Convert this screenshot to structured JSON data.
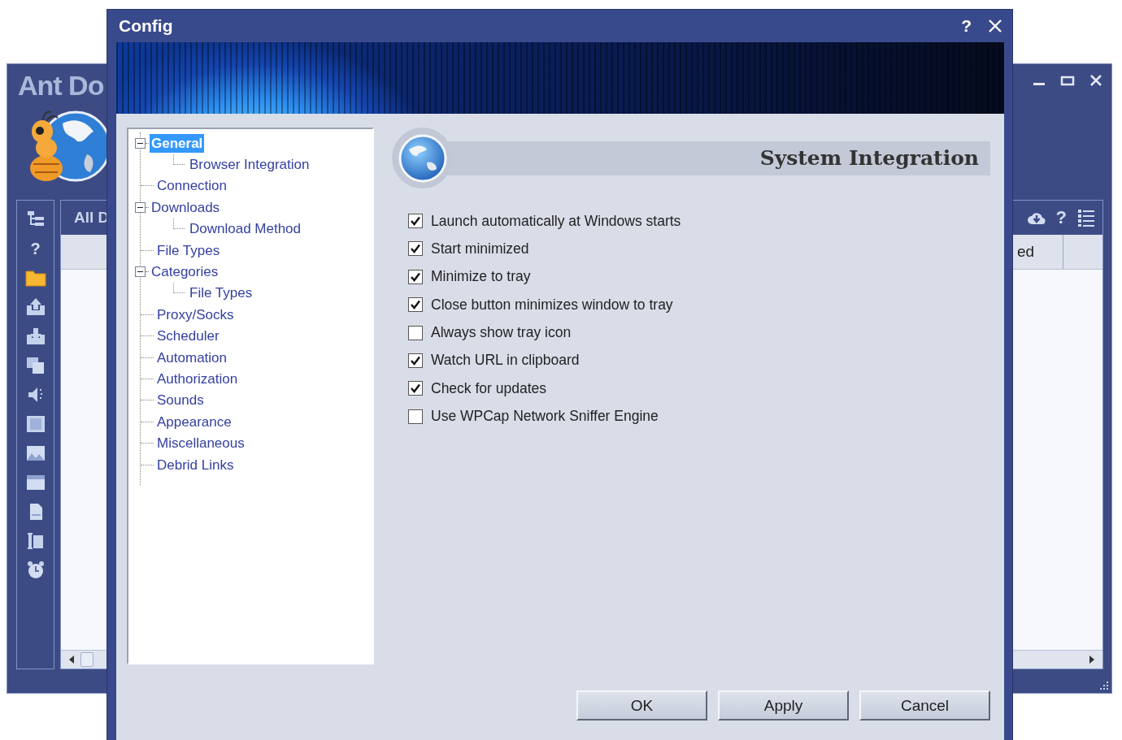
{
  "background_window": {
    "title": "Ant Do",
    "toolbar_help": "?",
    "tab": "All D",
    "column_header": "ed",
    "header_help": "?"
  },
  "dialog": {
    "title": "Config",
    "help": "?"
  },
  "tree": [
    {
      "label": "General",
      "selected": true,
      "expanded": true,
      "children": [
        {
          "label": "Browser Integration",
          "selected": false
        }
      ]
    },
    {
      "label": "Connection",
      "selected": false
    },
    {
      "label": "Downloads",
      "selected": false,
      "expanded": true,
      "children": [
        {
          "label": "Download Method",
          "selected": false
        }
      ]
    },
    {
      "label": "File Types",
      "selected": false
    },
    {
      "label": "Categories",
      "selected": false,
      "expanded": true,
      "children": [
        {
          "label": "File Types",
          "selected": false
        }
      ]
    },
    {
      "label": "Proxy/Socks",
      "selected": false
    },
    {
      "label": "Scheduler",
      "selected": false
    },
    {
      "label": "Automation",
      "selected": false
    },
    {
      "label": "Authorization",
      "selected": false
    },
    {
      "label": "Sounds",
      "selected": false
    },
    {
      "label": "Appearance",
      "selected": false
    },
    {
      "label": "Miscellaneous",
      "selected": false
    },
    {
      "label": "Debrid Links",
      "selected": false
    }
  ],
  "section_title": "System Integration",
  "options": [
    {
      "label": "Launch automatically at Windows starts",
      "checked": true
    },
    {
      "label": "Start minimized",
      "checked": true
    },
    {
      "label": "Minimize to tray",
      "checked": true
    },
    {
      "label": "Close button minimizes window to tray",
      "checked": true
    },
    {
      "label": "Always show tray icon",
      "checked": false
    },
    {
      "label": "Watch URL in clipboard",
      "checked": true
    },
    {
      "label": "Check for updates",
      "checked": true
    },
    {
      "label": "Use WPCap Network Sniffer Engine",
      "checked": false
    }
  ],
  "buttons": [
    "OK",
    "Apply",
    "Cancel"
  ]
}
